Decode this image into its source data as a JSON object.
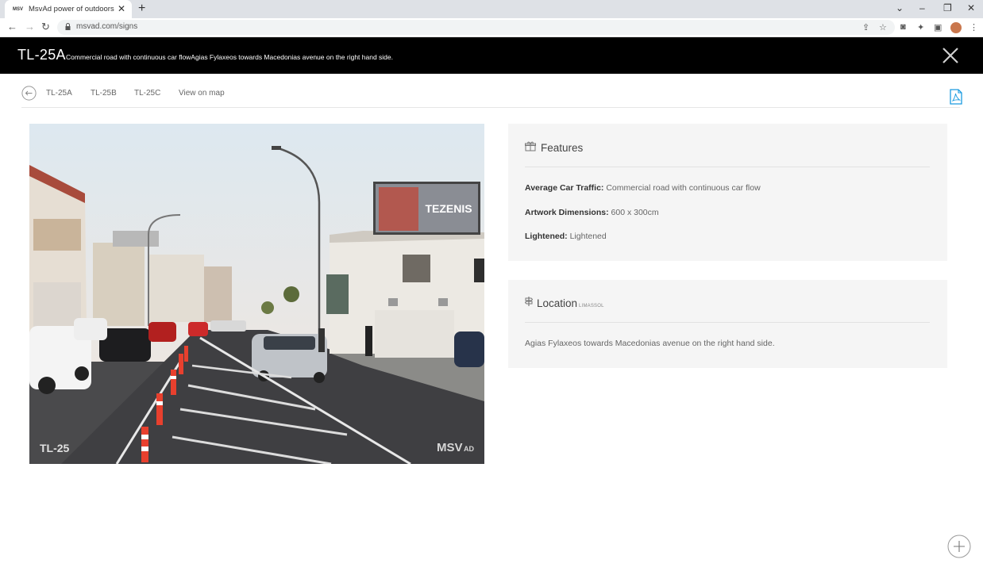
{
  "browser": {
    "tab_title": "MsvAd power of outdoors",
    "tab_favicon": "MSV",
    "url": "msvad.com/signs"
  },
  "header": {
    "code": "TL-25A",
    "description": "Commercial road with continuous car flowAgias Fylaxeos towards Macedonias avenue on the right hand side."
  },
  "subnav": {
    "links": [
      "TL-25A",
      "TL-25B",
      "TL-25C",
      "View on map"
    ]
  },
  "photo": {
    "watermark_code": "TL-25",
    "billboard_text": "TEZENIS",
    "brand_mark": "MSV",
    "brand_mark_suffix": "AD"
  },
  "features": {
    "title": "Features",
    "rows": [
      {
        "label": "Average Car Traffic:",
        "value": " Commercial road with continuous car flow"
      },
      {
        "label": "Artwork Dimensions:",
        "value": " 600 x 300cm"
      },
      {
        "label": "Lightened:",
        "value": " Lightened"
      }
    ]
  },
  "location": {
    "title": "Location",
    "city": "LIMASSOL",
    "text": "Agias Fylaxeos towards Macedonias avenue on the right hand side."
  },
  "colors": {
    "header_bg": "#000000",
    "panel_bg": "#f5f5f5",
    "pdf_icon": "#1a9be0"
  }
}
